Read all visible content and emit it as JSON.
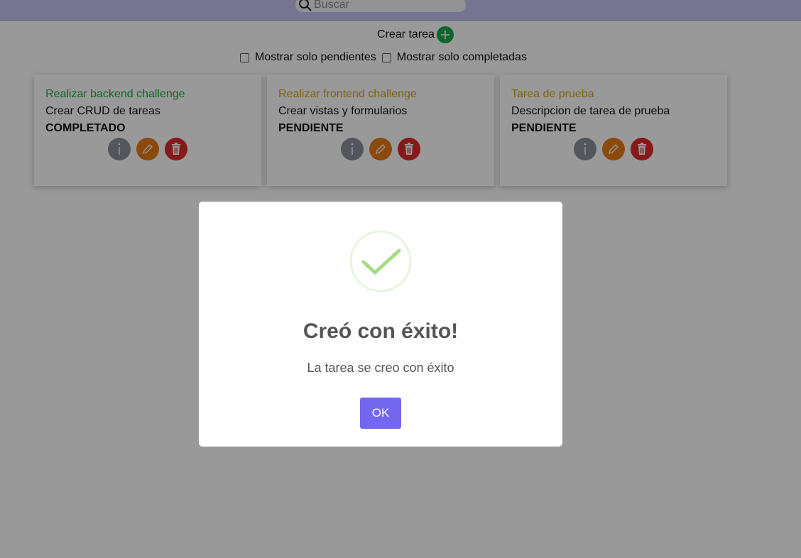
{
  "search": {
    "placeholder": "Buscar"
  },
  "toolbar": {
    "create_label": "Crear tarea"
  },
  "filters": {
    "pending_label": "Mostrar solo pendientes",
    "completed_label": "Mostrar solo completadas"
  },
  "tasks": [
    {
      "title": "Realizar backend challenge",
      "description": "Crear CRUD de tareas",
      "status": "COMPLETADO",
      "title_color": "#18a948"
    },
    {
      "title": "Realizar frontend challenge",
      "description": "Crear vistas y formularios",
      "status": "PENDIENTE",
      "title_color": "#d1a21a"
    },
    {
      "title": "Tarea de prueba",
      "description": "Descripcion de tarea de prueba",
      "status": "PENDIENTE",
      "title_color": "#d1a21a"
    }
  ],
  "icons": {
    "search": "search-icon",
    "add": "plus-icon",
    "info": "info-icon",
    "edit": "pencil-icon",
    "delete": "trash-icon",
    "success": "check-icon"
  },
  "modal": {
    "title": "Creó con éxito!",
    "message": "La tarea se creo con éxito",
    "ok_label": "OK"
  },
  "colors": {
    "topbar": "#c5c2f2",
    "accent": "#7367f0",
    "success": "#a5dc86",
    "add_button": "#18a948",
    "info_button": "#8a9099",
    "edit_button": "#ea7b14",
    "delete_button": "#e02a2a"
  }
}
